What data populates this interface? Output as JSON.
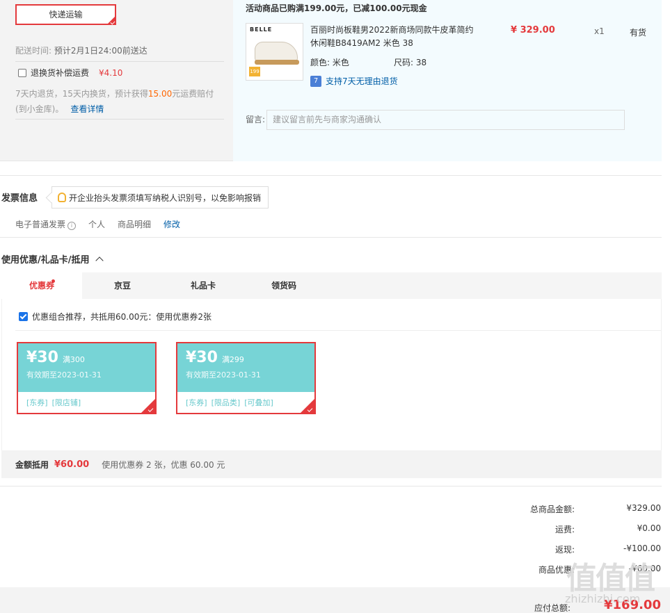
{
  "shipping": {
    "method_label": "快递运输",
    "delivery_label": "配送时间:",
    "delivery_value": "预计2月1日24:00前送达",
    "insurance_label": "退换货补偿运费",
    "insurance_price": "¥4.10",
    "insurance_desc_pre": "7天内退货，15天内换货，预计获得",
    "insurance_desc_amount": "15.00",
    "insurance_desc_post": "元运费赔付(到小金库)。",
    "insurance_link": "查看详情"
  },
  "goods": {
    "promo": "活动商品已购满199.00元，已减100.00元现金",
    "image_brand": "BELLE",
    "image_tag": "199",
    "title": "百丽时尚板鞋男2022新商场同款牛皮革简约休闲鞋B8419AM2 米色 38",
    "price": "¥ 329.00",
    "qty": "x1",
    "stock": "有货",
    "color_label": "颜色:",
    "color_value": "米色",
    "size_label": "尺码:",
    "size_value": "38",
    "return_icon": "7",
    "return_text": "支持7天无理由退货",
    "message_label": "留言:",
    "message_placeholder": "建议留言前先与商家沟通确认"
  },
  "invoice": {
    "title": "发票信息",
    "tip": "开企业抬头发票须填写纳税人识别号，以免影响报销",
    "type": "电子普通发票",
    "info_icon": "i",
    "holder": "个人",
    "content": "商品明细",
    "edit": "修改"
  },
  "coupons": {
    "title": "使用优惠/礼品卡/抵用",
    "tabs": [
      {
        "label": "优惠券"
      },
      {
        "label": "京豆"
      },
      {
        "label": "礼品卡"
      },
      {
        "label": "领货码"
      }
    ],
    "recommend_text": "优惠组合推荐，共抵用60.00元：使用优惠券2张",
    "items": [
      {
        "amount": "¥30",
        "condition": "满300",
        "valid": "有效期至2023-01-31",
        "tags": [
          "[东券]",
          "[限店铺]"
        ]
      },
      {
        "amount": "¥30",
        "condition": "满299",
        "valid": "有效期至2023-01-31",
        "tags": [
          "[东券]",
          "[限品类]",
          "[可叠加]"
        ]
      }
    ],
    "footer_label": "金额抵用",
    "footer_value": "¥60.00",
    "footer_desc": "使用优惠券 2 张，优惠 60.00 元"
  },
  "summary": {
    "rows": [
      {
        "label": "总商品金额:",
        "value": "¥329.00"
      },
      {
        "label": "运费:",
        "value": "¥0.00"
      },
      {
        "label": "返现:",
        "value": "-¥100.00"
      },
      {
        "label": "商品优惠:",
        "value": "-¥60.00"
      }
    ],
    "total_label": "应付总额:",
    "total_value": "¥169.00"
  },
  "watermark": {
    "text": "值值值",
    "url": "zhizhizhi.com"
  },
  "colors": {
    "accent": "#e4393c",
    "link": "#005ea7",
    "coupon": "#77d4d6"
  }
}
